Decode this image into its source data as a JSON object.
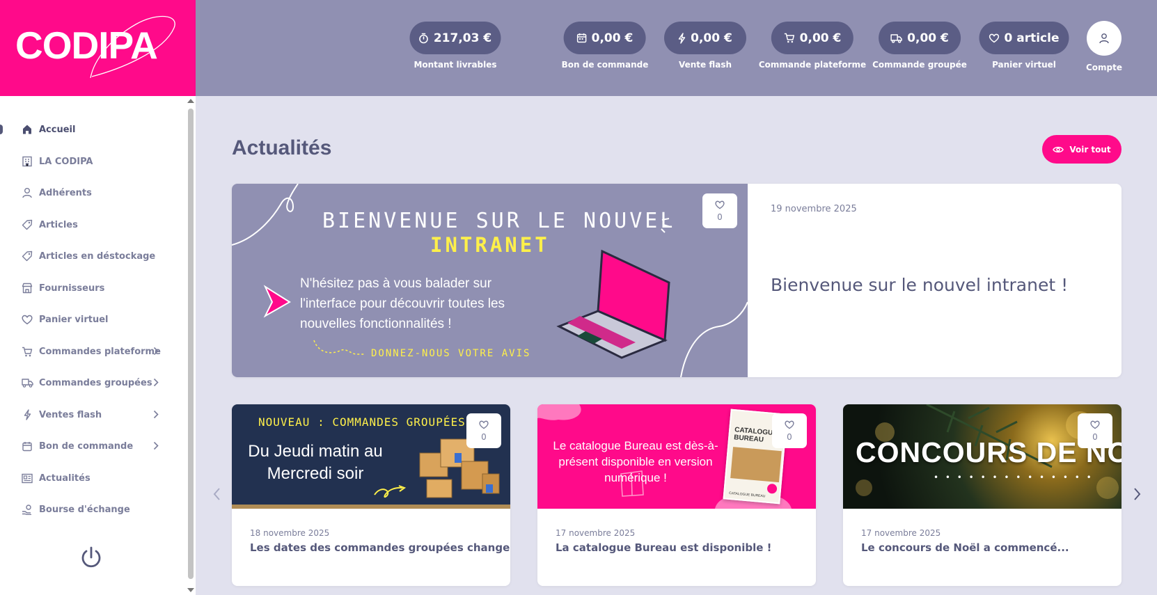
{
  "logo": {
    "text": "CODIPA"
  },
  "colors": {
    "brand_pink": "#ff0a8a",
    "header_bg": "#9090b2",
    "pill_bg": "#5b5d85",
    "page_bg": "#e1e1ee",
    "text_dark": "#55587a"
  },
  "header": {
    "stats": [
      {
        "icon": "stopwatch-icon",
        "value": "217,03 €",
        "label": "Montant livrables"
      },
      {
        "icon": "calendar-icon",
        "value": "0,00 €",
        "label": "Bon de commande"
      },
      {
        "icon": "lightning-icon",
        "value": "0,00 €",
        "label": "Vente flash"
      },
      {
        "icon": "cart-icon",
        "value": "0,00 €",
        "label": "Commande plateforme"
      },
      {
        "icon": "truck-icon",
        "value": "0,00 €",
        "label": "Commande groupée"
      },
      {
        "icon": "heart-icon",
        "value": "0 article",
        "label": "Panier virtuel"
      }
    ],
    "account_label": "Compte"
  },
  "sidebar": {
    "items": [
      {
        "label": "Accueil",
        "icon": "home-icon",
        "active": true,
        "submenu": false
      },
      {
        "label": "LA CODIPA",
        "icon": "building-icon",
        "active": false,
        "submenu": false
      },
      {
        "label": "Adhérents",
        "icon": "user-icon",
        "active": false,
        "submenu": false
      },
      {
        "label": "Articles",
        "icon": "tag-icon",
        "active": false,
        "submenu": false
      },
      {
        "label": "Articles en déstockage",
        "icon": "tag-icon",
        "active": false,
        "submenu": false
      },
      {
        "label": "Fournisseurs",
        "icon": "store-icon",
        "active": false,
        "submenu": false
      },
      {
        "label": "Panier virtuel",
        "icon": "heart-icon",
        "active": false,
        "submenu": false
      },
      {
        "label": "Commandes plateforme",
        "icon": "cart-icon",
        "active": false,
        "submenu": true
      },
      {
        "label": "Commandes groupées",
        "icon": "truck-icon",
        "active": false,
        "submenu": true
      },
      {
        "label": "Ventes flash",
        "icon": "lightning-icon",
        "active": false,
        "submenu": true
      },
      {
        "label": "Bon de commande",
        "icon": "calendar-icon",
        "active": false,
        "submenu": true
      },
      {
        "label": "Actualités",
        "icon": "news-icon",
        "active": false,
        "submenu": false
      },
      {
        "label": "Bourse d'échange",
        "icon": "exchange-icon",
        "active": false,
        "submenu": false
      }
    ]
  },
  "main": {
    "title": "Actualités",
    "see_all_label": "Voir tout",
    "featured": {
      "image_text": {
        "line1": "BIENVENUE SUR LE NOUVEL",
        "line2": "INTRANET",
        "body": "N'hésitez pas à vous balader sur l'interface pour découvrir toutes les nouvelles fonctionnalités !",
        "cta": "DONNEZ-NOUS VOTRE AVIS"
      },
      "likes": "0",
      "date": "19 novembre 2025",
      "title": "Bienvenue sur le nouvel intranet !"
    },
    "cards": [
      {
        "image_text": {
          "top": "NOUVEAU : COMMANDES GROUPÉES",
          "body": "Du Jeudi matin au Mercredi soir"
        },
        "likes": "0",
        "date": "18 novembre 2025",
        "title": "Les dates des commandes groupées changent !"
      },
      {
        "image_text": {
          "body": "Le catalogue Bureau est dès-à-présent disponible en version numérique !",
          "book_title": "CATALOGUE BUREAU",
          "book_footer": "CATALOGUE BUREAU"
        },
        "likes": "0",
        "date": "17 novembre 2025",
        "title": "La catalogue Bureau est disponible !"
      },
      {
        "image_text": {
          "body": "CONCOURS DE NOËL"
        },
        "likes": "0",
        "date": "17 novembre 2025",
        "title": "Le concours de Noël a commencé..."
      }
    ]
  }
}
